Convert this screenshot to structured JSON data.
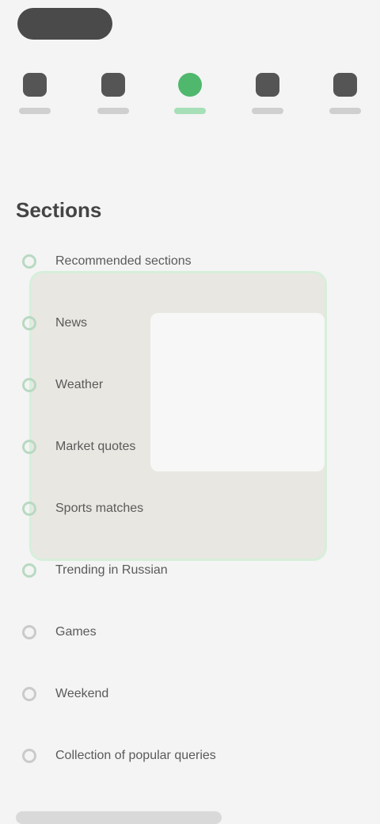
{
  "header": {
    "pill_label": ""
  },
  "tabs": [
    {
      "label": "",
      "icon": "tab-icon-1"
    },
    {
      "label": "",
      "icon": "tab-icon-2"
    },
    {
      "label": "",
      "icon": "tab-icon-3-active",
      "active": true
    },
    {
      "label": "",
      "icon": "tab-icon-4"
    },
    {
      "label": "",
      "icon": "tab-icon-5"
    }
  ],
  "subcaption": "",
  "section": {
    "title": "Sections"
  },
  "list": {
    "items": [
      {
        "label": "Recommended sections",
        "checked": true
      },
      {
        "label": "News",
        "checked": true
      },
      {
        "label": "Weather",
        "checked": true
      },
      {
        "label": "Market quotes",
        "checked": true
      },
      {
        "label": "Sports matches",
        "checked": true
      },
      {
        "label": "Trending in Russian",
        "checked": true
      },
      {
        "label": "Games",
        "checked": false
      },
      {
        "label": "Weekend",
        "checked": false
      },
      {
        "label": "Collection of popular queries",
        "checked": false
      }
    ]
  },
  "colors": {
    "accent": "#4fb86d",
    "background": "#f4f4f4",
    "popup": "#e9e7e1"
  }
}
